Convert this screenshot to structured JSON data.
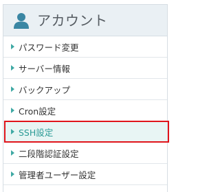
{
  "header": {
    "title": "アカウント",
    "icon": "user-icon",
    "icon_color": "#3a86a3"
  },
  "menu": {
    "items": [
      {
        "label": "パスワード変更",
        "active": false
      },
      {
        "label": "サーバー情報",
        "active": false
      },
      {
        "label": "バックアップ",
        "active": false
      },
      {
        "label": "Cron設定",
        "active": false
      },
      {
        "label": "SSH設定",
        "active": true
      },
      {
        "label": "二段階認証設定",
        "active": false
      },
      {
        "label": "管理者ユーザー設定",
        "active": false
      }
    ]
  },
  "colors": {
    "accent": "#3fa9a4",
    "highlight_border": "#e0131a",
    "active_background": "#e8f5f4",
    "header_background": "#eaf0f4"
  }
}
